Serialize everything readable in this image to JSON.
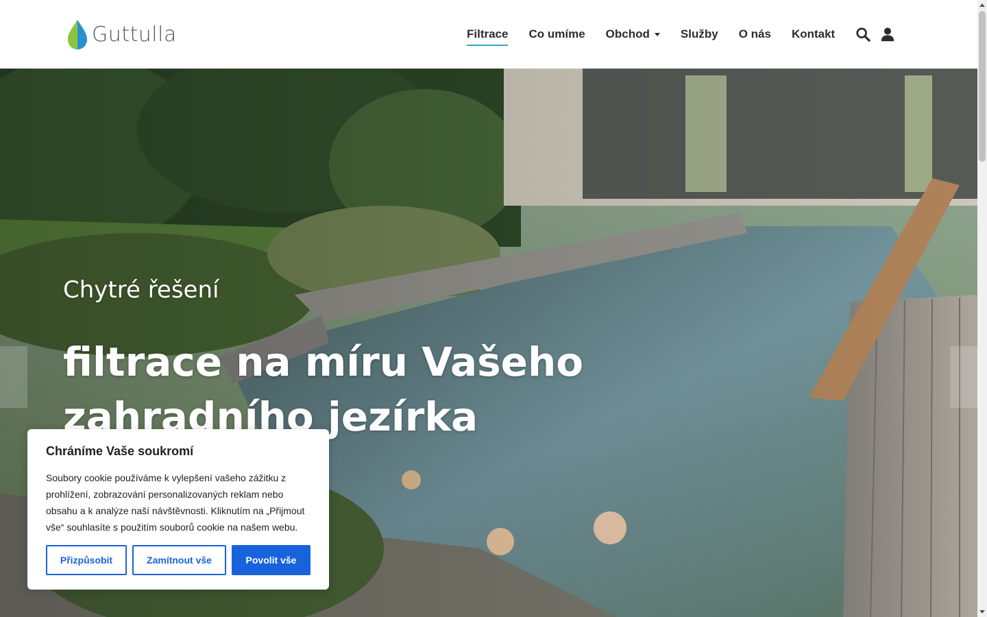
{
  "brand": {
    "name": "Guttulla",
    "accent": "#2aa8c9"
  },
  "nav": {
    "items": [
      {
        "label": "Filtrace"
      },
      {
        "label": "Co umíme"
      },
      {
        "label": "Obchod"
      },
      {
        "label": "Služby"
      },
      {
        "label": "O nás"
      },
      {
        "label": "Kontakt"
      }
    ],
    "icons": [
      "search-icon",
      "user-icon"
    ]
  },
  "hero": {
    "subtitle": "Chytré řešení",
    "title": "filtrace na míru Vašeho zahradního jezírka"
  },
  "cookie": {
    "title": "Chráníme Vaše soukromí",
    "text": "Soubory cookie používáme k vylepšení vašeho zážitku z prohlížení, zobrazování personalizovaných reklam nebo obsahu a k analýze naší návštěvnosti. Kliknutím na „Přijmout vše“ souhlasíte s použitím souborů cookie na našem webu.",
    "buttons": {
      "customize": "Přizpůsobit",
      "reject": "Zamítnout vše",
      "accept": "Povolit vše"
    },
    "button_color": "#1863dc"
  }
}
